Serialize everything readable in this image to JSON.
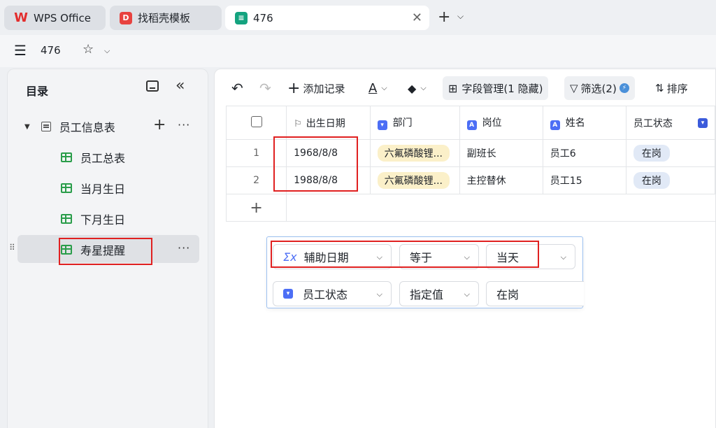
{
  "tabs": [
    {
      "label": "WPS Office"
    },
    {
      "label": "找稻壳模板"
    },
    {
      "label": "476"
    }
  ],
  "doc": {
    "title": "476"
  },
  "sidebar": {
    "title": "目录",
    "root": "员工信息表",
    "items": [
      "员工总表",
      "当月生日",
      "下月生日",
      "寿星提醒"
    ]
  },
  "toolbar": {
    "add_record": "添加记录",
    "field_mgmt": "字段管理(1 隐藏)",
    "filter": "筛选(2)",
    "sort": "排序"
  },
  "table": {
    "columns": [
      "出生日期",
      "部门",
      "岗位",
      "姓名",
      "员工状态"
    ],
    "rows": [
      {
        "num": "1",
        "birth": "1968/8/8",
        "dept": "六氟磷酸锂...",
        "post": "副班长",
        "name": "员工6",
        "status": "在岗"
      },
      {
        "num": "2",
        "birth": "1988/8/8",
        "dept": "六氟磷酸锂...",
        "post": "主控替休",
        "name": "员工15",
        "status": "在岗"
      }
    ]
  },
  "filters": [
    {
      "field": "辅助日期",
      "op": "等于",
      "value": "当天"
    },
    {
      "field": "员工状态",
      "op": "指定值",
      "value": "在岗"
    }
  ],
  "colors": {
    "accent": "#4c6ef5",
    "highlight": "#e02020",
    "green": "#2a9d4a"
  }
}
